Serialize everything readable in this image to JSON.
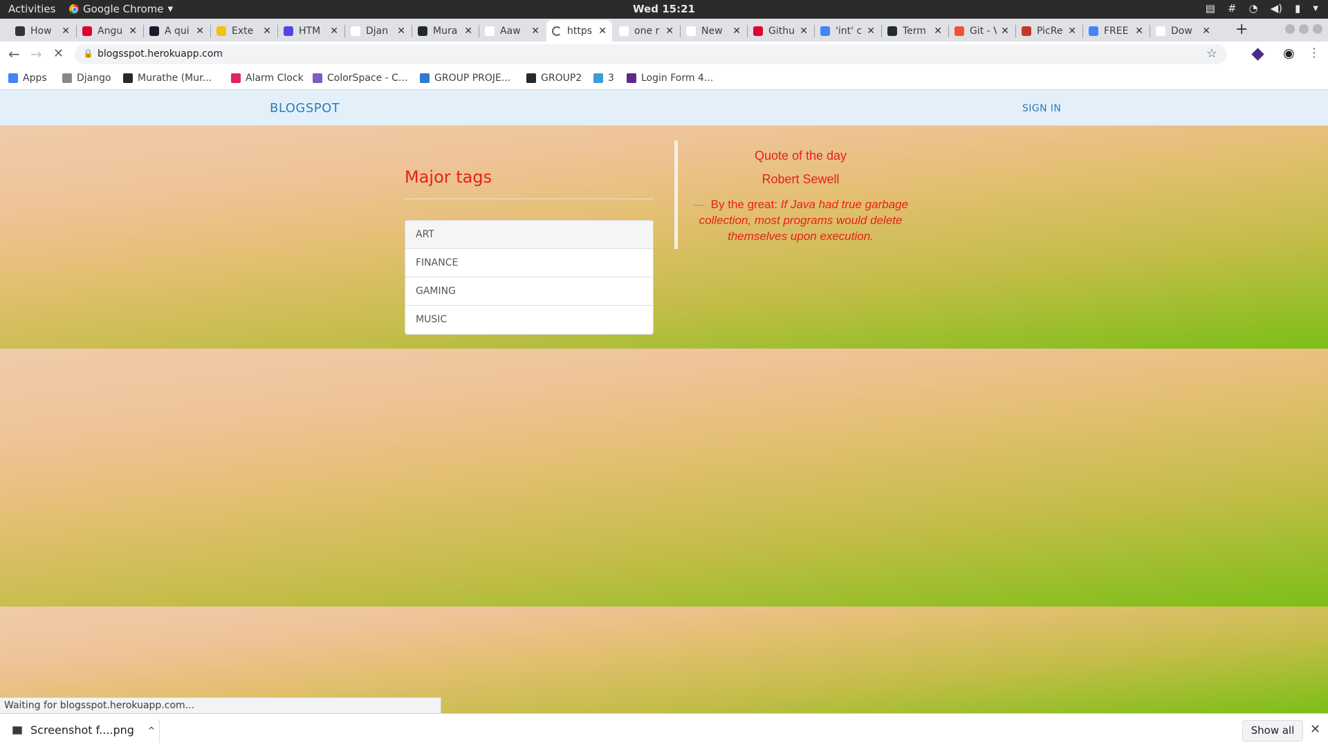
{
  "system": {
    "activities": "Activities",
    "app_menu": "Google Chrome",
    "clock": "Wed 15:21"
  },
  "tabs": [
    {
      "title": "How",
      "favicon_color": "#333333"
    },
    {
      "title": "Angu",
      "favicon_color": "#dd0031"
    },
    {
      "title": "A qui",
      "favicon_color": "#1a1a2e"
    },
    {
      "title": "Exte",
      "favicon_color": "#f4c20d"
    },
    {
      "title": "HTM",
      "favicon_color": "#4f46e5"
    },
    {
      "title": "Djan",
      "favicon_color": "#ffffff"
    },
    {
      "title": "Mura",
      "favicon_color": "#24292e"
    },
    {
      "title": "Aaw",
      "favicon_color": "#ffffff"
    },
    {
      "title": "https",
      "favicon_color": "#ffffff"
    },
    {
      "title": "one r",
      "favicon_color": "#ffffff"
    },
    {
      "title": "New",
      "favicon_color": "#ffffff"
    },
    {
      "title": "Githu",
      "favicon_color": "#dd0031"
    },
    {
      "title": "'int' c",
      "favicon_color": "#4285f4"
    },
    {
      "title": "Term",
      "favicon_color": "#24292e"
    },
    {
      "title": "Git - V",
      "favicon_color": "#f05133"
    },
    {
      "title": "PicRe",
      "favicon_color": "#c0392b"
    },
    {
      "title": "FREE",
      "favicon_color": "#4285f4"
    },
    {
      "title": "Dow",
      "favicon_color": "#ffffff"
    }
  ],
  "active_tab_index": 8,
  "omnibox": {
    "url": "blogsspot.herokuapp.com"
  },
  "bookmarks": [
    {
      "label": "Apps",
      "icon": "apps-grid-icon",
      "color": "#4285f4"
    },
    {
      "label": "Django",
      "icon": "django-icon",
      "color": "#888888"
    },
    {
      "label": "Murathe (Mur...",
      "icon": "github-icon",
      "color": "#24292e"
    },
    {
      "label": "Alarm Clock",
      "icon": "k-logo-icon",
      "color": "#e0245e"
    },
    {
      "label": "ColorSpace - C...",
      "icon": "colorspace-icon",
      "color": "#7b5cc4"
    },
    {
      "label": "GROUP PROJE...",
      "icon": "trello-icon",
      "color": "#2e7bcf"
    },
    {
      "label": "GROUP2",
      "icon": "github-icon",
      "color": "#24292e"
    },
    {
      "label": "3",
      "icon": "mdb-icon",
      "color": "#3b9dd8"
    },
    {
      "label": "Login Form 4...",
      "icon": "form-icon",
      "color": "#5b2c8a"
    }
  ],
  "site": {
    "brand": "BLOGSPOT",
    "signin": "SIGN IN",
    "tags_heading": "Major tags",
    "tags": [
      "ART",
      "FINANCE",
      "GAMING",
      "MUSIC"
    ],
    "quote_title": "Quote of the day",
    "quote_author": "Robert Sewell",
    "quote_dash": "—",
    "quote_prefix": "By the great:",
    "quote_text": "If Java had true garbage collection, most programs would delete themselves upon execution.",
    "accent_color": "#e8201c",
    "brand_color": "#2e7bb7"
  },
  "status_text": "Waiting for blogsspot.herokuapp.com...",
  "downloads": {
    "file": "Screenshot f....png",
    "show_all": "Show all"
  }
}
